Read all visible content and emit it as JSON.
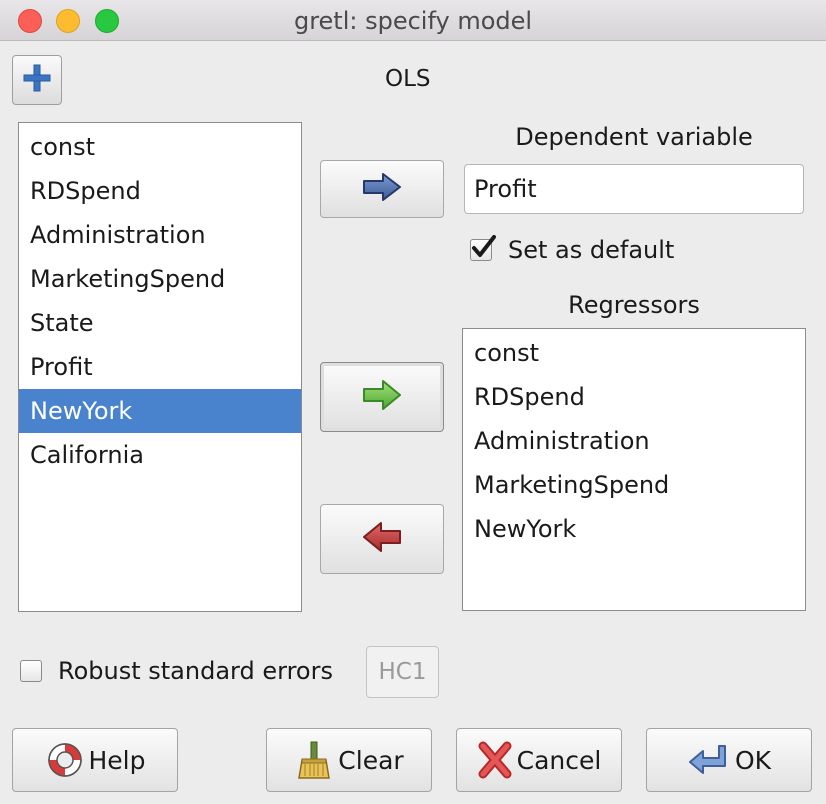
{
  "window": {
    "title": "gretl: specify model"
  },
  "estimator": "OLS",
  "variables": [
    "const",
    "RDSpend",
    "Administration",
    "MarketingSpend",
    "State",
    "Profit",
    "NewYork",
    "California"
  ],
  "selected_variable": "NewYork",
  "dependent": {
    "label": "Dependent variable",
    "value": "Profit"
  },
  "set_default": {
    "label": "Set as default",
    "checked": true
  },
  "regressors": {
    "label": "Regressors",
    "items": [
      "const",
      "RDSpend",
      "Administration",
      "MarketingSpend",
      "NewYork"
    ]
  },
  "robust": {
    "label": "Robust standard errors",
    "checked": false,
    "hc_label": "HC1"
  },
  "buttons": {
    "help": "Help",
    "clear": "Clear",
    "cancel": "Cancel",
    "ok": "OK"
  },
  "colors": {
    "selection": "#4a83cd",
    "arrow_dependent": "#4a6aa8",
    "arrow_add": "#6bc24a",
    "arrow_remove": "#c03838"
  }
}
